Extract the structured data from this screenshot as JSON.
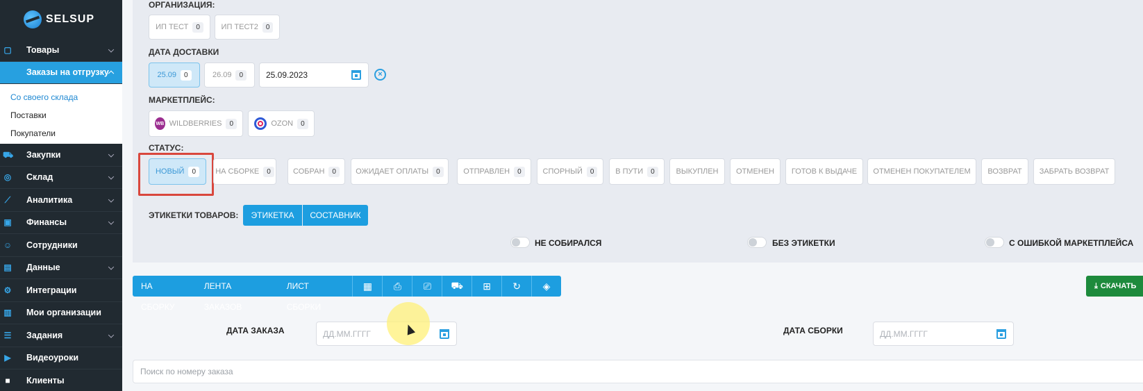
{
  "brand": {
    "name": "SELSUP"
  },
  "sidebar": {
    "items_top": [
      {
        "label": "Товары",
        "icon": "bag-icon"
      },
      {
        "label": "Заказы на отгрузку",
        "icon": "orders-icon"
      }
    ],
    "submenu": [
      {
        "label": "Со своего склада"
      },
      {
        "label": "Поставки"
      },
      {
        "label": "Покупатели"
      }
    ],
    "items_bottom": [
      {
        "label": "Закупки",
        "icon": "cart-icon"
      },
      {
        "label": "Склад",
        "icon": "warehouse-icon"
      },
      {
        "label": "Аналитика",
        "icon": "chart-icon"
      },
      {
        "label": "Финансы",
        "icon": "wallet-icon"
      },
      {
        "label": "Сотрудники",
        "icon": "user-icon"
      },
      {
        "label": "Данные",
        "icon": "doc-icon"
      },
      {
        "label": "Интеграции",
        "icon": "plug-icon"
      },
      {
        "label": "Мои организации",
        "icon": "building-icon"
      },
      {
        "label": "Задания",
        "icon": "tasks-icon"
      },
      {
        "label": "Видеоуроки",
        "icon": "video-icon"
      },
      {
        "label": "Клиенты",
        "icon": "lock-icon"
      }
    ]
  },
  "filters": {
    "organization": {
      "label": "ОРГАНИЗАЦИЯ:",
      "chips": [
        {
          "label": "ИП ТЕСТ",
          "count": "0"
        },
        {
          "label": "ИП ТЕСТ2",
          "count": "0"
        }
      ]
    },
    "delivery_date": {
      "label": "ДАТА ДОСТАВКИ",
      "chips": [
        {
          "label": "25.09",
          "count": "0"
        },
        {
          "label": "26.09",
          "count": "0"
        }
      ],
      "input_value": "25.09.2023"
    },
    "marketplace": {
      "label": "МАРКЕТПЛЕЙС:",
      "chips": [
        {
          "label": "WILDBERRIES",
          "count": "0",
          "badge": "WB"
        },
        {
          "label": "OZON",
          "count": "0"
        }
      ]
    },
    "status": {
      "label": "СТАТУС:",
      "chips": [
        {
          "label": "НОВЫЙ",
          "count": "0"
        },
        {
          "label": "НА СБОРКЕ",
          "count": "0"
        },
        {
          "label": "СОБРАН",
          "count": "0"
        },
        {
          "label": "ОЖИДАЕТ ОПЛАТЫ",
          "count": "0"
        },
        {
          "label": "ОТПРАВЛЕН",
          "count": "0"
        },
        {
          "label": "СПОРНЫЙ",
          "count": "0"
        },
        {
          "label": "В ПУТИ",
          "count": "0"
        },
        {
          "label": "ВЫКУПЛЕН"
        },
        {
          "label": "ОТМЕНЕН"
        },
        {
          "label": "ГОТОВ К ВЫДАЧЕ"
        },
        {
          "label": "ОТМЕНЕН ПОКУПАТЕЛЕМ"
        },
        {
          "label": "ВОЗВРАТ"
        },
        {
          "label": "ЗАБРАТЬ ВОЗВРАТ"
        }
      ]
    },
    "labels": {
      "label": "ЭТИКЕТКИ ТОВАРОВ:",
      "buttons": [
        "ЭТИКЕТКА",
        "СОСТАВНИК"
      ]
    },
    "toggles": [
      {
        "label": "НЕ СОБИРАЛСЯ"
      },
      {
        "label": "БЕЗ ЭТИКЕТКИ"
      },
      {
        "label": "С ОШИБКОЙ МАРКЕТПЛЕЙСА"
      }
    ]
  },
  "action_bar": {
    "text_buttons": [
      "НА СБОРКУ",
      "ЛЕНТА ЗАКАЗОВ",
      "ЛИСТ СБОРКИ"
    ],
    "icons": [
      "pdf-icon",
      "download-doc-icon",
      "print-icon",
      "truck-icon",
      "basket-icon",
      "refresh-icon",
      "tag-icon"
    ],
    "download_label": "СКАЧАТЬ"
  },
  "dates": {
    "order_date_label": "ДАТА ЗАКАЗА",
    "order_date_placeholder": "ДД.ММ.ГГГГ",
    "assembly_date_label": "ДАТА СБОРКИ",
    "assembly_date_placeholder": "ДД.ММ.ГГГГ"
  },
  "search": {
    "placeholder": "Поиск по номеру заказа"
  },
  "colors": {
    "accent": "#1d9ee0",
    "sidebar": "#212a31",
    "highlight": "#d9473d",
    "download": "#1d8a3c"
  }
}
